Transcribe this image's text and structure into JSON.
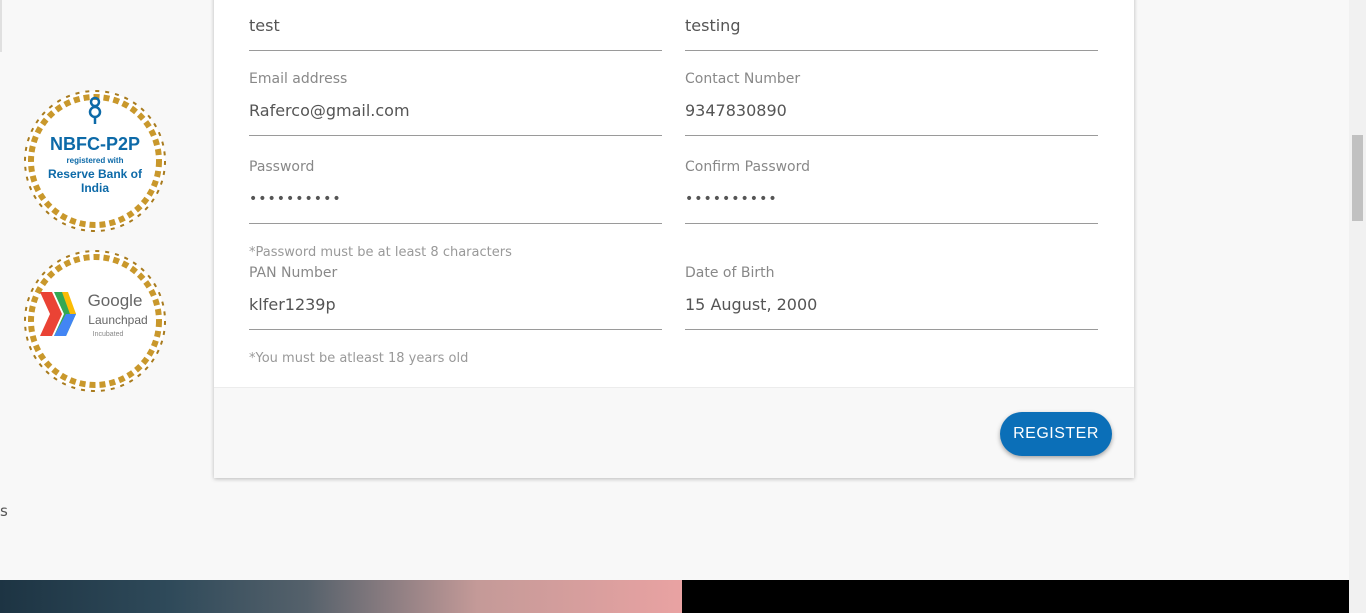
{
  "form": {
    "first_name_value": "test",
    "last_name_value": "testing",
    "email": {
      "label": "Email address",
      "value": "Raferco@gmail.com"
    },
    "contact": {
      "label": "Contact Number",
      "value": "9347830890"
    },
    "password": {
      "label": "Password",
      "value": "••••••••••"
    },
    "confirm_password": {
      "label": "Confirm Password",
      "value": "••••••••••"
    },
    "password_hint": "*Password must be at least 8 characters",
    "pan": {
      "label": "PAN Number",
      "value": "klfer1239p"
    },
    "dob": {
      "label": "Date of Birth",
      "value": "15 August, 2000"
    },
    "age_hint": "*You must be atleast 18 years old",
    "register_label": "REGISTER"
  },
  "badges": {
    "nbfc": {
      "line1": "NBFC-P2P",
      "line2": "registered with",
      "line3": "Reserve Bank of",
      "line4": "India"
    },
    "google": {
      "line1": "Google",
      "line2": "Launchpad",
      "line3": "Incubated"
    }
  },
  "stray_text": "s",
  "colors": {
    "accent": "#0b6fb8",
    "nbfc_text": "#0d6aa8",
    "laurel_gold": "#c9982c"
  }
}
